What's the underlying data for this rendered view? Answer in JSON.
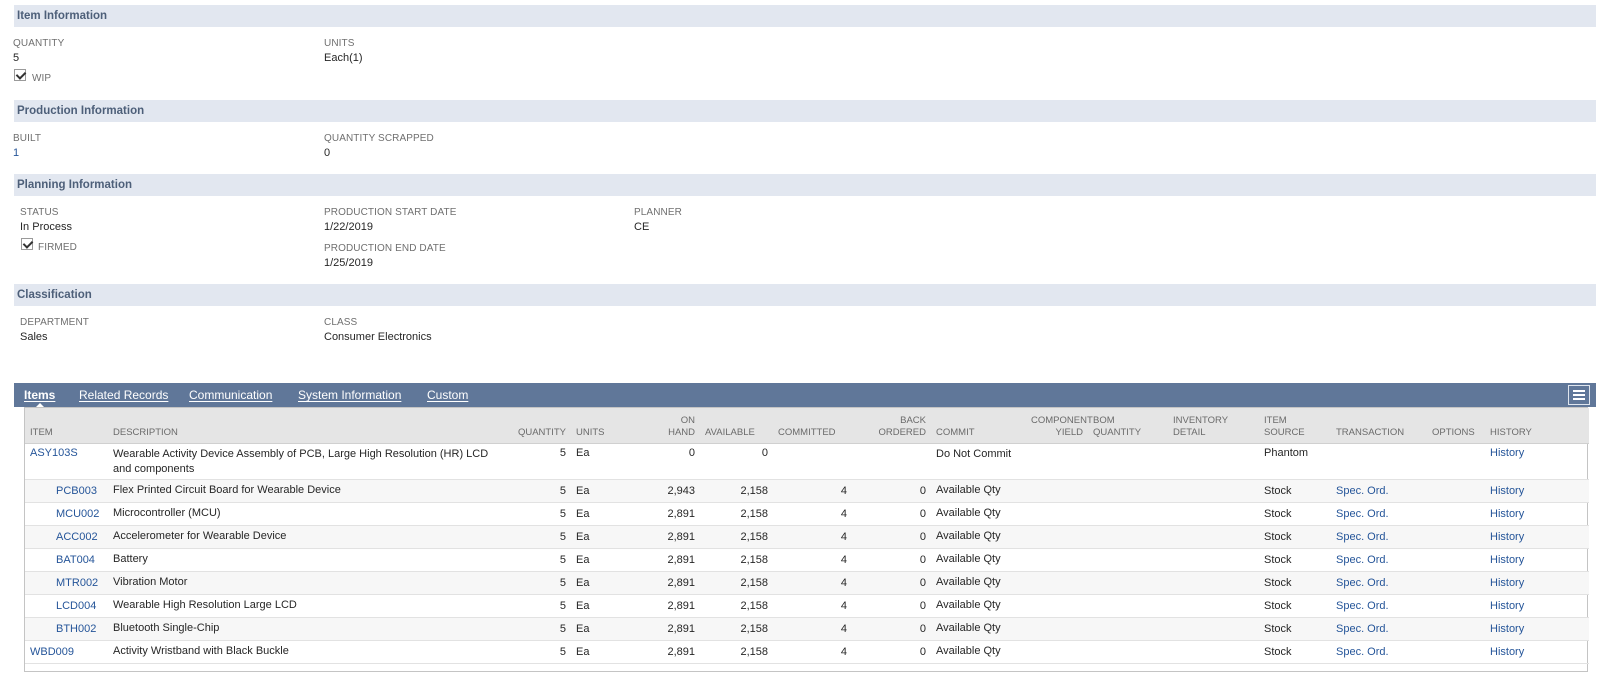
{
  "item_information": {
    "header": "Item Information",
    "quantity_label": "QUANTITY",
    "quantity_value": "5",
    "units_label": "UNITS",
    "units_value": "Each(1)",
    "wip_label": "WIP",
    "wip_checked": true
  },
  "production_information": {
    "header": "Production Information",
    "built_label": "BUILT",
    "built_value": "1",
    "scrapped_label": "QUANTITY SCRAPPED",
    "scrapped_value": "0"
  },
  "planning_information": {
    "header": "Planning Information",
    "status_label": "STATUS",
    "status_value": "In Process",
    "firmed_label": "FIRMED",
    "firmed_checked": true,
    "start_label": "PRODUCTION START DATE",
    "start_value": "1/22/2019",
    "end_label": "PRODUCTION END DATE",
    "end_value": "1/25/2019",
    "planner_label": "PLANNER",
    "planner_value": "CE"
  },
  "classification": {
    "header": "Classification",
    "department_label": "DEPARTMENT",
    "department_value": "Sales",
    "class_label": "CLASS",
    "class_value": "Consumer Electronics"
  },
  "tabs": [
    {
      "label": "Items",
      "active": true
    },
    {
      "label": "Related Records",
      "active": false
    },
    {
      "label": "Communication",
      "active": false
    },
    {
      "label": "System Information",
      "active": false
    },
    {
      "label": "Custom",
      "active": false
    }
  ],
  "items_table": {
    "columns": {
      "item": "ITEM",
      "description": "DESCRIPTION",
      "quantity": "QUANTITY",
      "units": "UNITS",
      "on_hand_1": "ON",
      "on_hand_2": "HAND",
      "available": "AVAILABLE",
      "committed": "COMMITTED",
      "back_ordered_1": "BACK",
      "back_ordered_2": "ORDERED",
      "commit": "COMMIT",
      "component_yield_1": "COMPONENT",
      "component_yield_2": "YIELD",
      "bom_quantity_1": "BOM",
      "bom_quantity_2": "QUANTITY",
      "inventory_detail_1": "INVENTORY",
      "inventory_detail_2": "DETAIL",
      "item_source_1": "ITEM",
      "item_source_2": "SOURCE",
      "transaction": "TRANSACTION",
      "options": "OPTIONS",
      "history": "HISTORY"
    },
    "rows": [
      {
        "item": "ASY103S",
        "description": "Wearable Activity Device Assembly of PCB, Large High Resolution (HR) LCD and components",
        "quantity": "5",
        "units": "Ea",
        "on_hand": "0",
        "available": "0",
        "committed": "",
        "back_ordered": "",
        "commit": "Do Not Commit",
        "component_yield": "",
        "bom_quantity": "",
        "inventory_detail": "",
        "item_source": "Phantom",
        "transaction": "",
        "options": "",
        "history": "History"
      },
      {
        "item": "PCB003",
        "description": "Flex Printed Circuit Board for Wearable Device",
        "quantity": "5",
        "units": "Ea",
        "on_hand": "2,943",
        "available": "2,158",
        "committed": "4",
        "back_ordered": "0",
        "commit": "Available Qty",
        "component_yield": "",
        "bom_quantity": "",
        "inventory_detail": "",
        "item_source": "Stock",
        "transaction": "Spec. Ord.",
        "options": "",
        "history": "History"
      },
      {
        "item": "MCU002",
        "description": "Microcontroller (MCU)",
        "quantity": "5",
        "units": "Ea",
        "on_hand": "2,891",
        "available": "2,158",
        "committed": "4",
        "back_ordered": "0",
        "commit": "Available Qty",
        "component_yield": "",
        "bom_quantity": "",
        "inventory_detail": "",
        "item_source": "Stock",
        "transaction": "Spec. Ord.",
        "options": "",
        "history": "History"
      },
      {
        "item": "ACC002",
        "description": "Accelerometer for Wearable Device",
        "quantity": "5",
        "units": "Ea",
        "on_hand": "2,891",
        "available": "2,158",
        "committed": "4",
        "back_ordered": "0",
        "commit": "Available Qty",
        "component_yield": "",
        "bom_quantity": "",
        "inventory_detail": "",
        "item_source": "Stock",
        "transaction": "Spec. Ord.",
        "options": "",
        "history": "History"
      },
      {
        "item": "BAT004",
        "description": "Battery",
        "quantity": "5",
        "units": "Ea",
        "on_hand": "2,891",
        "available": "2,158",
        "committed": "4",
        "back_ordered": "0",
        "commit": "Available Qty",
        "component_yield": "",
        "bom_quantity": "",
        "inventory_detail": "",
        "item_source": "Stock",
        "transaction": "Spec. Ord.",
        "options": "",
        "history": "History"
      },
      {
        "item": "MTR002",
        "description": "Vibration Motor",
        "quantity": "5",
        "units": "Ea",
        "on_hand": "2,891",
        "available": "2,158",
        "committed": "4",
        "back_ordered": "0",
        "commit": "Available Qty",
        "component_yield": "",
        "bom_quantity": "",
        "inventory_detail": "",
        "item_source": "Stock",
        "transaction": "Spec. Ord.",
        "options": "",
        "history": "History"
      },
      {
        "item": "LCD004",
        "description": "Wearable High Resolution Large LCD",
        "quantity": "5",
        "units": "Ea",
        "on_hand": "2,891",
        "available": "2,158",
        "committed": "4",
        "back_ordered": "0",
        "commit": "Available Qty",
        "component_yield": "",
        "bom_quantity": "",
        "inventory_detail": "",
        "item_source": "Stock",
        "transaction": "Spec. Ord.",
        "options": "",
        "history": "History"
      },
      {
        "item": "BTH002",
        "description": "Bluetooth Single-Chip",
        "quantity": "5",
        "units": "Ea",
        "on_hand": "2,891",
        "available": "2,158",
        "committed": "4",
        "back_ordered": "0",
        "commit": "Available Qty",
        "component_yield": "",
        "bom_quantity": "",
        "inventory_detail": "",
        "item_source": "Stock",
        "transaction": "Spec. Ord.",
        "options": "",
        "history": "History"
      },
      {
        "item": "WBD009",
        "description": "Activity Wristband with Black Buckle",
        "quantity": "5",
        "units": "Ea",
        "on_hand": "2,891",
        "available": "2,158",
        "committed": "4",
        "back_ordered": "0",
        "commit": "Available Qty",
        "component_yield": "",
        "bom_quantity": "",
        "inventory_detail": "",
        "item_source": "Stock",
        "transaction": "Spec. Ord.",
        "options": "",
        "history": "History"
      }
    ]
  },
  "colors": {
    "section_header_bg": "#e2e7f0",
    "section_header_text": "#4d5f79",
    "tabbar_bg": "#607799",
    "link": "#255599"
  }
}
